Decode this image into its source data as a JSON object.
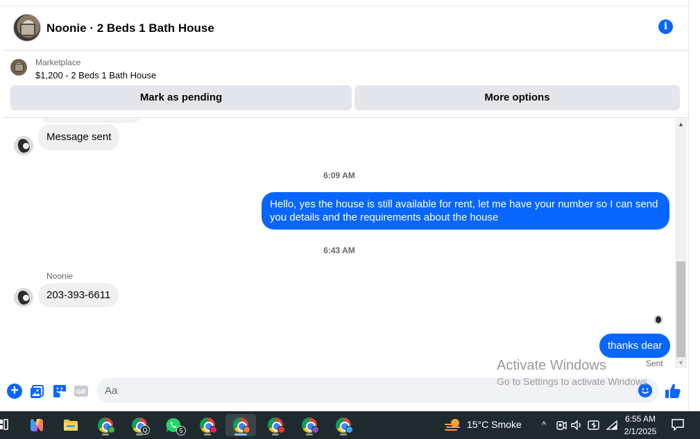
{
  "header": {
    "title": "Noonie · 2 Beds 1 Bath House",
    "info_label": "i"
  },
  "marketplace": {
    "label": "Marketplace",
    "item": "$1,200 - 2 Beds 1 Bath House",
    "mark_pending_label": "Mark as pending",
    "more_options_label": "More options"
  },
  "messages": {
    "first_in": "Message sent",
    "time_1": "6:09 AM",
    "out_1": "Hello, yes the house is still available for rent, let me have your number so I can send you details and the requirements about the house",
    "time_2": "6:43 AM",
    "sender_name": "Noonie",
    "in_2": "203-393-6611",
    "out_2": "thanks dear",
    "status": "Sent"
  },
  "composer": {
    "placeholder": "Aa",
    "gif_label": "GIF",
    "plus_label": "+"
  },
  "watermark": {
    "title": "Activate Windows",
    "subtitle": "Go to Settings to activate Windows."
  },
  "taskbar": {
    "weather": "15°C  Smoke",
    "time": "6:55 AM",
    "date": "2/1/2025",
    "whatsapp_badge": "5",
    "chrome_badge": "Q"
  },
  "colors": {
    "accent": "#0866ff",
    "incoming_bubble": "#f0f0f0",
    "taskbar": "#1f2a2e"
  }
}
